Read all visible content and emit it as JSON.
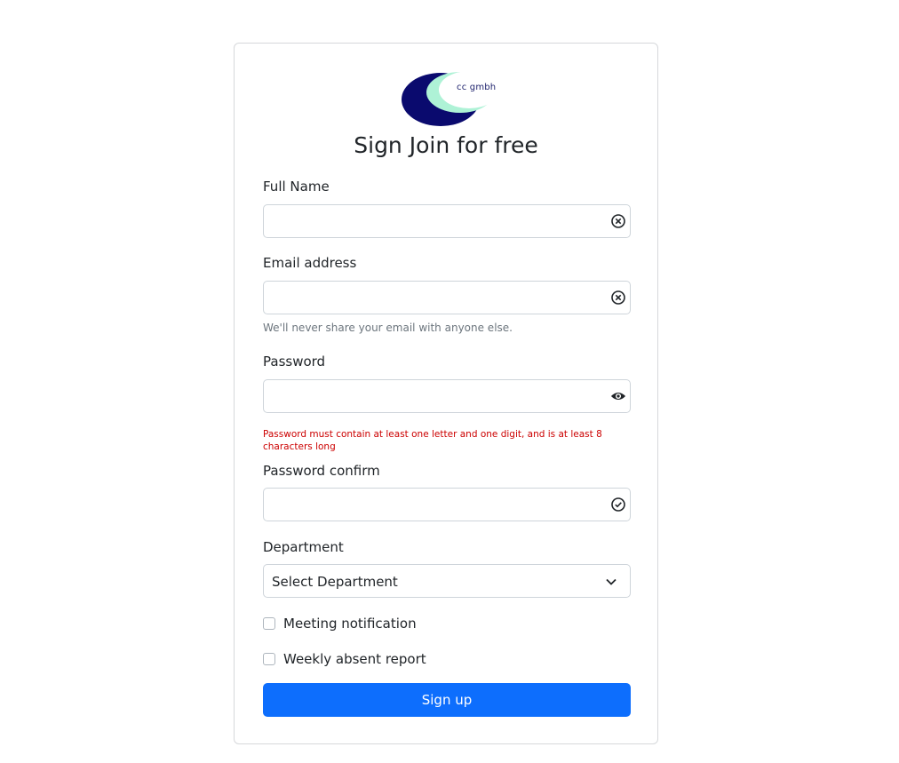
{
  "brand": {
    "logo_text": "cc gmbh",
    "colors": {
      "dark": "#0a0a6e",
      "light": "#aef2d6"
    }
  },
  "form": {
    "title": "Sign Join for free",
    "full_name": {
      "label": "Full Name",
      "value": "",
      "icon": "clear-circle-icon"
    },
    "email": {
      "label": "Email address",
      "value": "",
      "icon": "clear-circle-icon",
      "help": "We'll never share your email with anyone else."
    },
    "password": {
      "label": "Password",
      "value": "",
      "icon": "eye-icon",
      "error": "Password must contain at least one letter and one digit, and is at least 8 characters long"
    },
    "password_confirm": {
      "label": "Password confirm",
      "value": "",
      "icon": "check-circle-icon"
    },
    "department": {
      "label": "Department",
      "selected": "Select Department"
    },
    "checkboxes": [
      {
        "label": "Meeting notification",
        "checked": false
      },
      {
        "label": "Weekly absent report",
        "checked": false
      }
    ],
    "submit_label": "Sign up"
  },
  "colors": {
    "primary": "#0d6efd",
    "error": "#cc0000",
    "border": "#ced4da",
    "muted": "#6c757d"
  }
}
